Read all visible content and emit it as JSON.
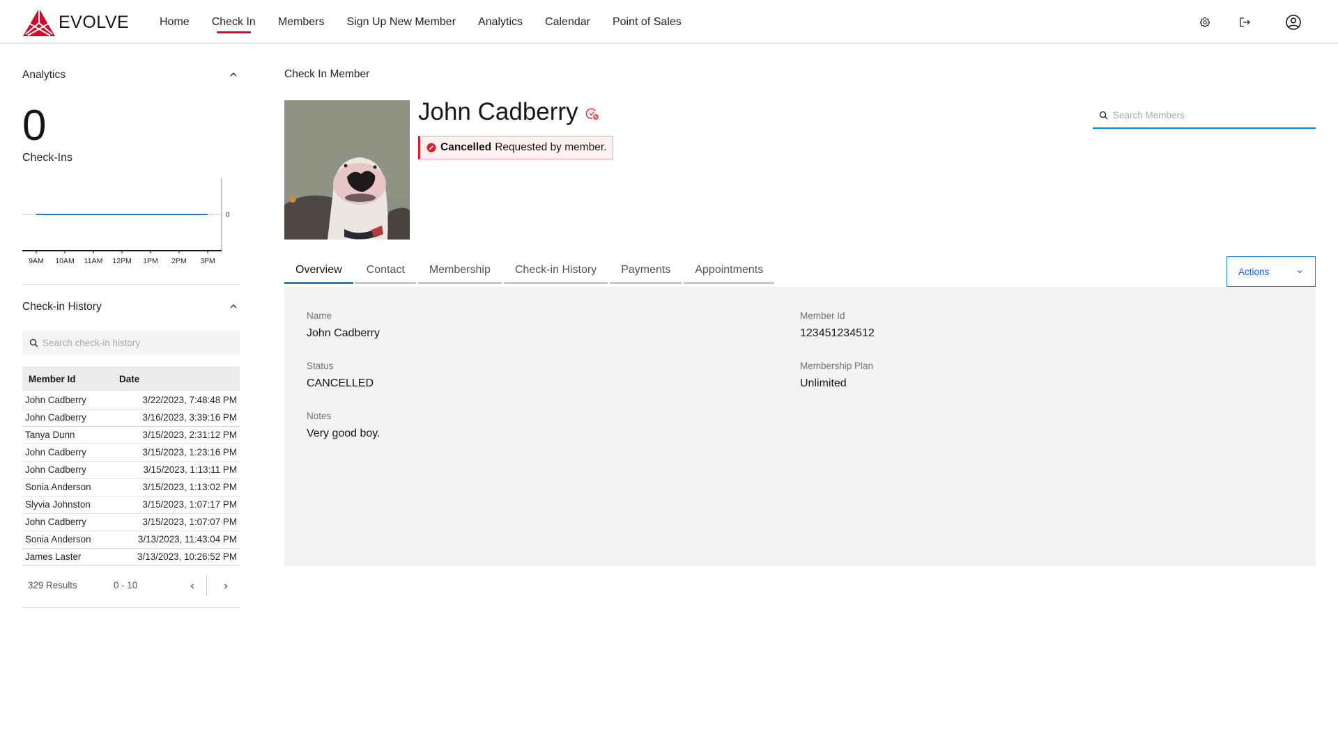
{
  "header": {
    "brand": "EVOLVE",
    "brand_color": "#c8102e",
    "nav": [
      {
        "label": "Home",
        "active": false
      },
      {
        "label": "Check In",
        "active": true
      },
      {
        "label": "Members",
        "active": false
      },
      {
        "label": "Sign Up New Member",
        "active": false
      },
      {
        "label": "Analytics",
        "active": false
      },
      {
        "label": "Calendar",
        "active": false
      },
      {
        "label": "Point of Sales",
        "active": false
      }
    ],
    "icons": [
      "gear-icon",
      "logout-icon",
      "user-avatar-icon"
    ]
  },
  "sidebar": {
    "analytics": {
      "title": "Analytics",
      "count": "0",
      "count_label": "Check-Ins"
    },
    "history": {
      "title": "Check-in History",
      "search_placeholder": "Search check-in history",
      "columns": [
        "Member Id",
        "Date"
      ],
      "rows": [
        {
          "member": "John Cadberry",
          "date": "3/22/2023, 7:48:48 PM"
        },
        {
          "member": "John Cadberry",
          "date": "3/16/2023, 3:39:16 PM"
        },
        {
          "member": "Tanya Dunn",
          "date": "3/15/2023, 2:31:12 PM"
        },
        {
          "member": "John Cadberry",
          "date": "3/15/2023, 1:23:16 PM"
        },
        {
          "member": "John Cadberry",
          "date": "3/15/2023, 1:13:11 PM"
        },
        {
          "member": "Sonia Anderson",
          "date": "3/15/2023, 1:13:02 PM"
        },
        {
          "member": "Slyvia Johnston",
          "date": "3/15/2023, 1:07:17 PM"
        },
        {
          "member": "John Cadberry",
          "date": "3/15/2023, 1:07:07 PM"
        },
        {
          "member": "Sonia Anderson",
          "date": "3/13/2023, 11:43:04 PM"
        },
        {
          "member": "James Laster",
          "date": "3/13/2023, 10:26:52 PM"
        }
      ],
      "results": "329 Results",
      "range": "0 - 10"
    }
  },
  "chart_data": {
    "type": "line",
    "title": "",
    "categories": [
      "9AM",
      "10AM",
      "11AM",
      "12PM",
      "1PM",
      "2PM",
      "3PM"
    ],
    "series": [
      {
        "name": "Check-Ins",
        "values": [
          0,
          0,
          0,
          0,
          0,
          0,
          0
        ],
        "color": "#0f7fd9"
      }
    ],
    "y_ticks": [
      "0"
    ],
    "ylim": [
      -1,
      1
    ],
    "xlabel": "",
    "ylabel": "",
    "y_axis_side": "right",
    "grid": false
  },
  "main": {
    "title": "Check In Member",
    "member_name": "John Cadberry",
    "notice": {
      "strong": "Cancelled",
      "text": "Requested by member."
    },
    "search_placeholder": "Search Members",
    "tabs": [
      {
        "label": "Overview",
        "active": true
      },
      {
        "label": "Contact",
        "active": false
      },
      {
        "label": "Membership",
        "active": false
      },
      {
        "label": "Check-in History",
        "active": false
      },
      {
        "label": "Payments",
        "active": false
      },
      {
        "label": "Appointments",
        "active": false
      }
    ],
    "actions_label": "Actions",
    "fields": {
      "name": {
        "label": "Name",
        "value": "John Cadberry"
      },
      "status": {
        "label": "Status",
        "value": "CANCELLED"
      },
      "notes": {
        "label": "Notes",
        "value": "Very good boy."
      },
      "member_id": {
        "label": "Member Id",
        "value": "123451234512"
      },
      "plan": {
        "label": "Membership Plan",
        "value": "Unlimited"
      }
    }
  }
}
